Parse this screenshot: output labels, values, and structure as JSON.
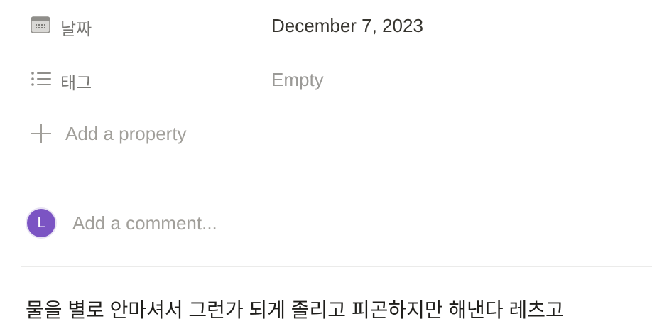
{
  "properties": [
    {
      "icon": "calendar-icon",
      "name": "날짜",
      "value": "December 7, 2023",
      "is_empty": false
    },
    {
      "icon": "list-icon",
      "name": "태그",
      "value": "Empty",
      "is_empty": true
    }
  ],
  "add_property": {
    "icon": "plus-icon",
    "label": "Add a property"
  },
  "comment": {
    "avatar_initial": "L",
    "avatar_color": "#7b54c3",
    "placeholder": "Add a comment..."
  },
  "body": {
    "text": "물을 별로 안마셔서 그런가 되게 졸리고 피곤하지만 해낸다 레츠고"
  }
}
